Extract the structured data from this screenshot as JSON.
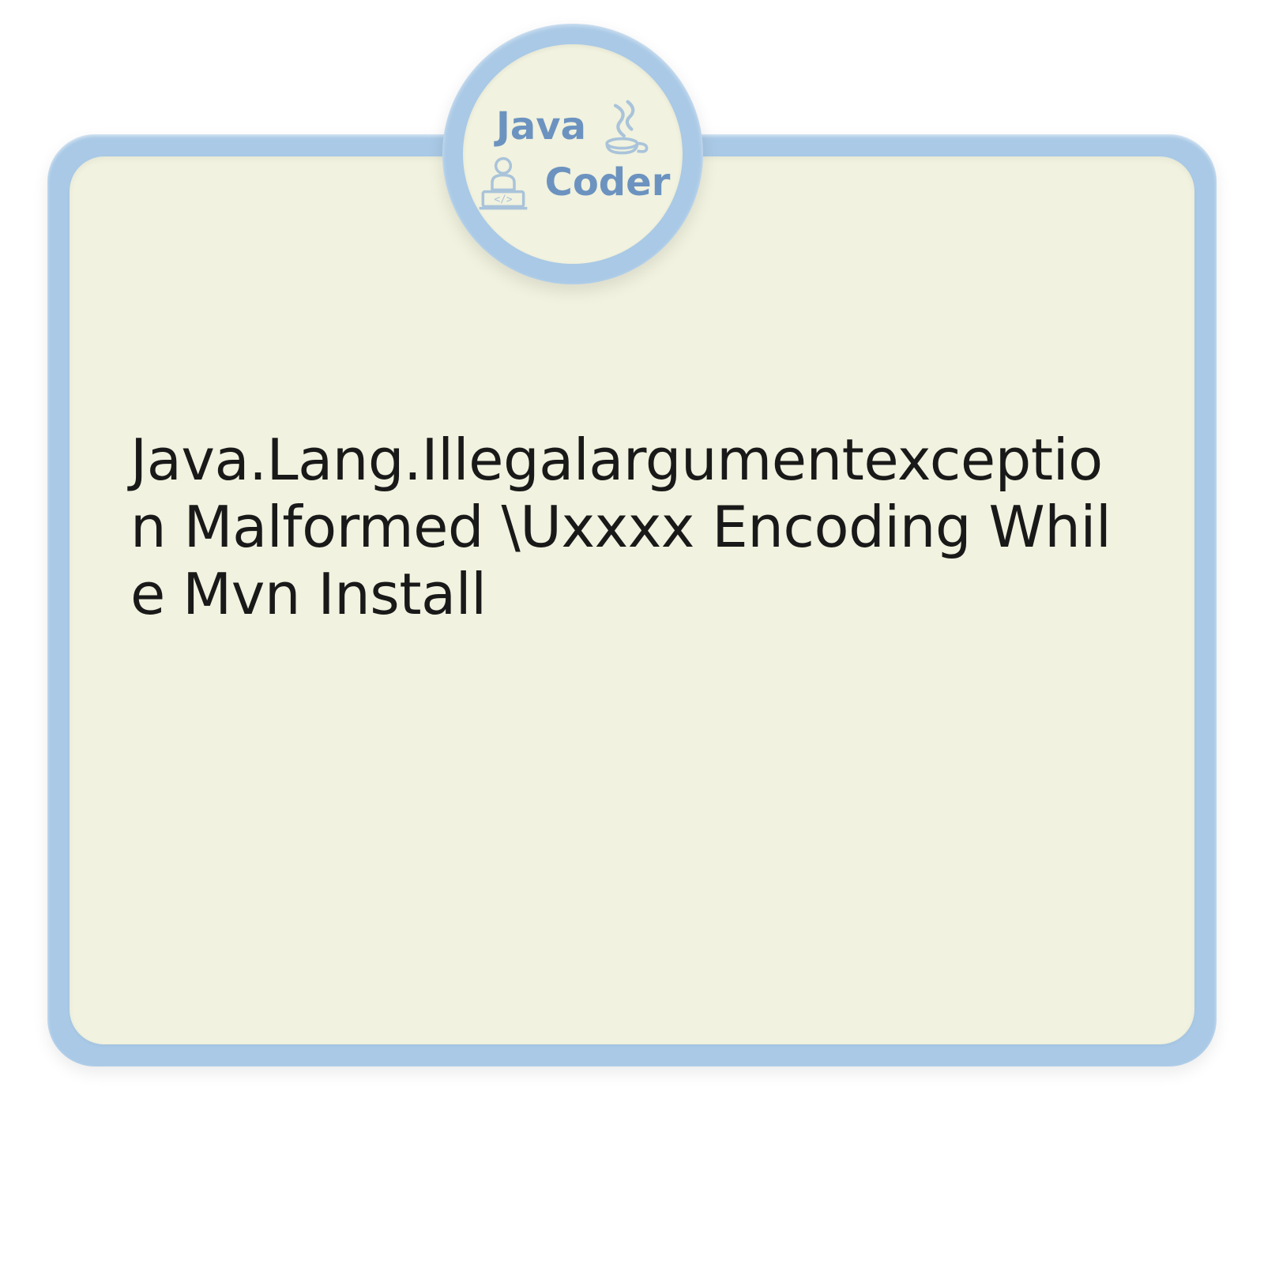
{
  "badge": {
    "line1": "Java",
    "line2": "Coder",
    "icon1": "java-coffee-icon",
    "icon2": "developer-icon"
  },
  "content": {
    "title": "Java.Lang.Illegalargumentexception Malformed \\Uxxxx Encoding While Mvn Install"
  },
  "colors": {
    "frame": "#a9c9e6",
    "panel": "#f1f2df",
    "badgeText": "#6c93c0",
    "contentText": "#191919"
  }
}
